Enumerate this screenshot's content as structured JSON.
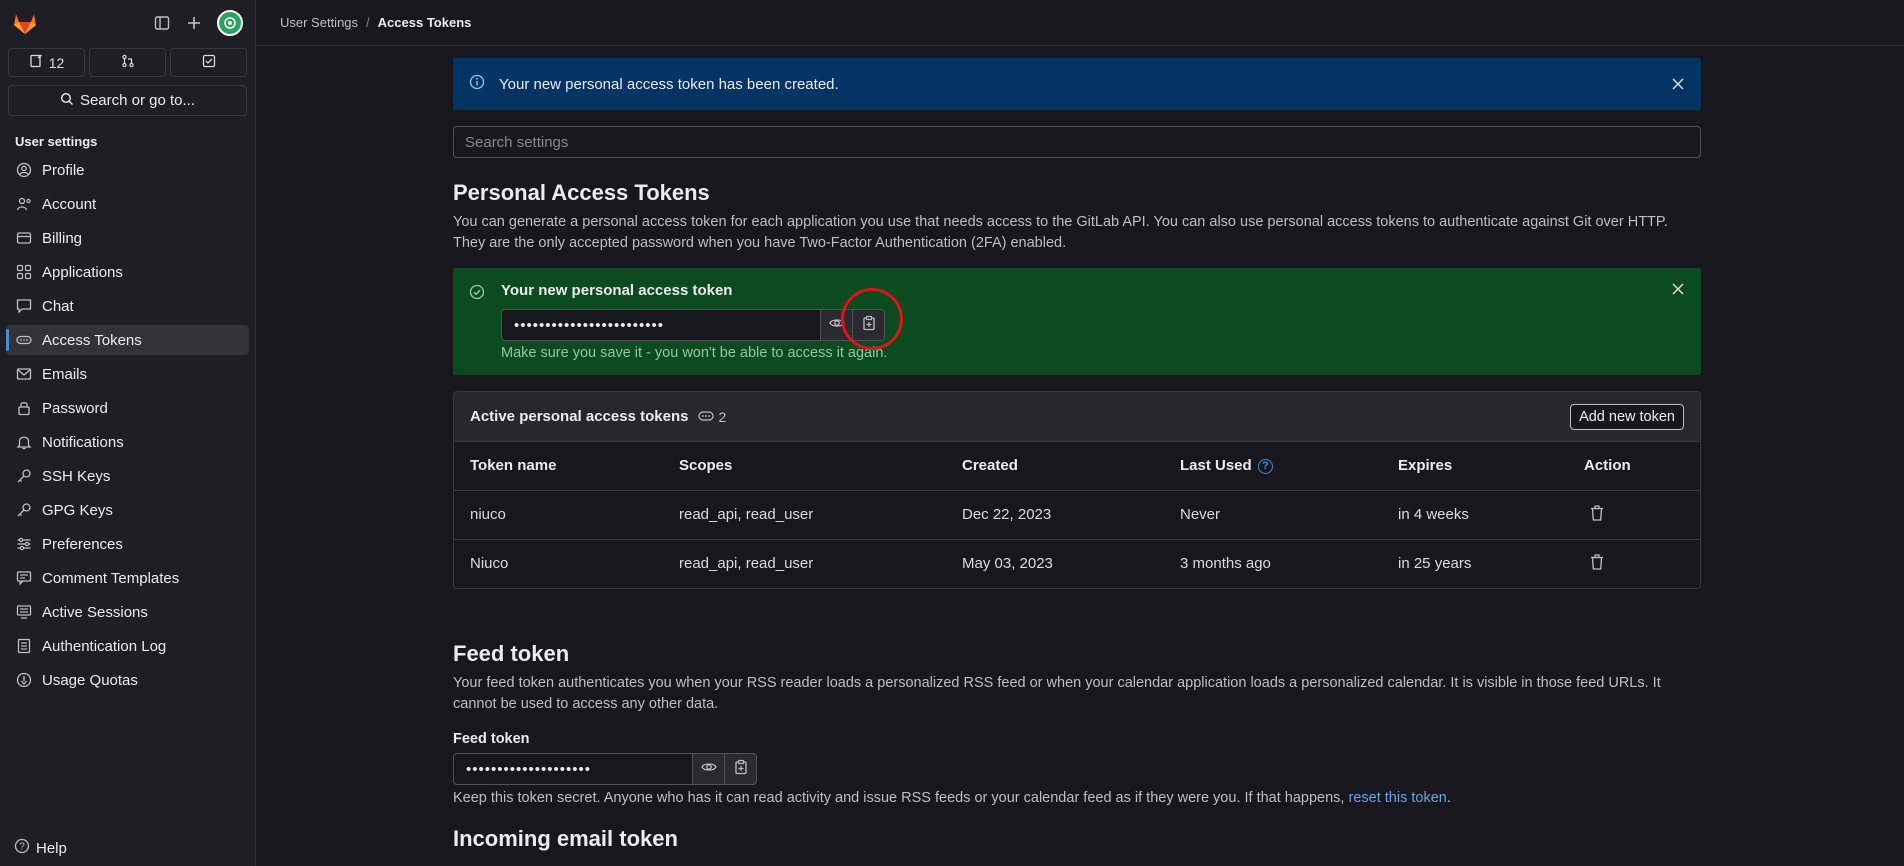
{
  "breadcrumb": {
    "parent": "User Settings",
    "separator": "/",
    "current": "Access Tokens"
  },
  "sidebar": {
    "counters": {
      "issues": "12"
    },
    "search_label": "Search or go to...",
    "section_title": "User settings",
    "items": [
      {
        "label": "Profile",
        "icon": "profile-icon"
      },
      {
        "label": "Account",
        "icon": "account-icon"
      },
      {
        "label": "Billing",
        "icon": "billing-icon"
      },
      {
        "label": "Applications",
        "icon": "applications-icon"
      },
      {
        "label": "Chat",
        "icon": "chat-icon"
      },
      {
        "label": "Access Tokens",
        "icon": "token-icon",
        "active": true
      },
      {
        "label": "Emails",
        "icon": "mail-icon"
      },
      {
        "label": "Password",
        "icon": "lock-icon"
      },
      {
        "label": "Notifications",
        "icon": "bell-icon"
      },
      {
        "label": "SSH Keys",
        "icon": "key-icon"
      },
      {
        "label": "GPG Keys",
        "icon": "key-icon"
      },
      {
        "label": "Preferences",
        "icon": "preferences-icon"
      },
      {
        "label": "Comment Templates",
        "icon": "comment-icon"
      },
      {
        "label": "Active Sessions",
        "icon": "monitor-icon"
      },
      {
        "label": "Authentication Log",
        "icon": "log-icon"
      },
      {
        "label": "Usage Quotas",
        "icon": "quota-icon"
      }
    ],
    "help_label": "Help"
  },
  "alert_info": {
    "text": "Your new personal access token has been created."
  },
  "search_settings": {
    "placeholder": "Search settings"
  },
  "pat": {
    "title": "Personal Access Tokens",
    "description_1": "You can generate a personal access token for each application you use that needs access to the GitLab API. You can also use personal access tokens to authenticate against Git over HTTP.",
    "description_2": "They are the only accepted password when you have Two-Factor Authentication (2FA) enabled.",
    "new_token": {
      "title": "Your new personal access token",
      "masked_value": "••••••••••••••••••••••••",
      "hint": "Make sure you save it - you won't be able to access it again."
    },
    "active": {
      "title": "Active personal access tokens",
      "count": "2",
      "add_button": "Add new token",
      "columns": [
        "Token name",
        "Scopes",
        "Created",
        "Last Used",
        "Expires",
        "Action"
      ],
      "rows": [
        {
          "name": "niuco",
          "scopes": "read_api, read_user",
          "created": "Dec 22, 2023",
          "last_used": "Never",
          "expires": "in 4 weeks"
        },
        {
          "name": "Niuco",
          "scopes": "read_api, read_user",
          "created": "May 03, 2023",
          "last_used": "3 months ago",
          "expires": "in 25 years"
        }
      ]
    }
  },
  "feed": {
    "title": "Feed token",
    "description_1": "Your feed token authenticates you when your RSS reader loads a personalized RSS feed or when your calendar application loads a personalized calendar. It is visible in those feed URLs. It",
    "description_2": "cannot be used to access any other data.",
    "label": "Feed token",
    "masked_value": "••••••••••••••••••••",
    "help_text": "Keep this token secret. Anyone who has it can read activity and issue RSS feeds or your calendar feed as if they were you. If that happens,",
    "reset_link": "reset this token",
    "help_end": "."
  },
  "incoming": {
    "title": "Incoming email token"
  },
  "colors": {
    "info_bg": "#033464",
    "success_bg": "#0c4a1f",
    "accent": "#428fdc",
    "highlight_circle": "#e0151b"
  }
}
